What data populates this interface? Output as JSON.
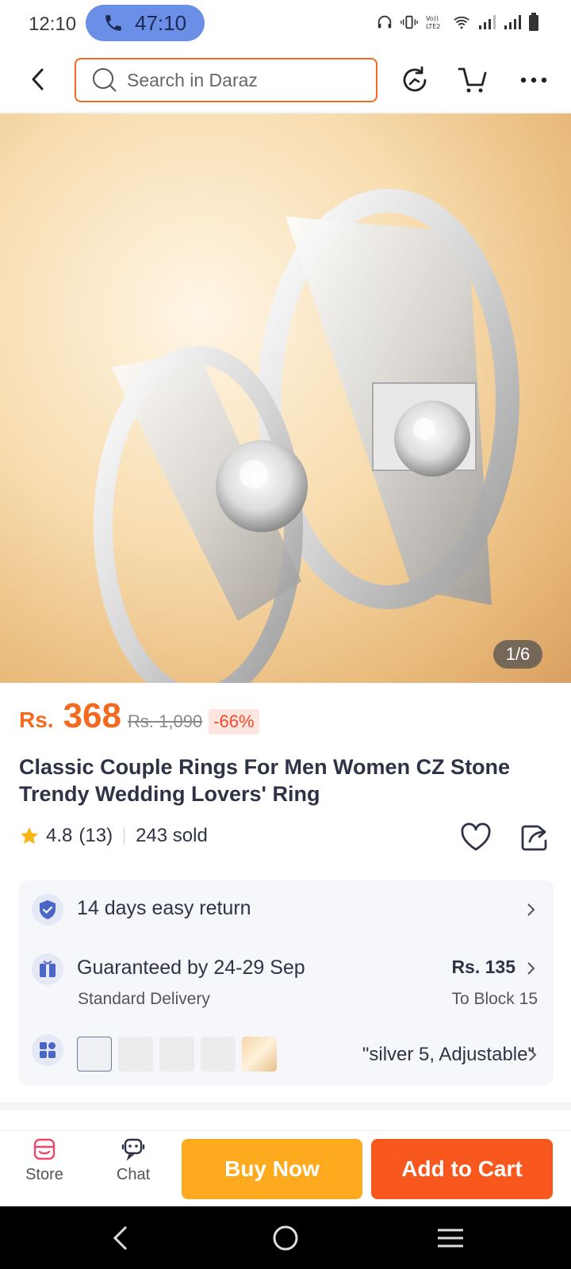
{
  "status_bar": {
    "time": "12:10",
    "call_duration": "47:10",
    "network_label": "Vo)) LTE2"
  },
  "header": {
    "search_placeholder": "Search in Daraz",
    "icons": [
      "back-arrow-icon",
      "search-icon",
      "refresh-icon",
      "cart-icon",
      "more-icon"
    ],
    "accent_color": "#f26a20"
  },
  "gallery": {
    "counter": "1/6"
  },
  "product": {
    "currency": "Rs.",
    "price": "368",
    "original_price": "Rs. 1,090",
    "discount": "-66%",
    "title": "Classic Couple Rings For Men Women CZ Stone Trendy Wedding Lovers' Ring",
    "rating": "4.8",
    "rating_count": "(13)",
    "sold": "243 sold"
  },
  "services": {
    "return_label": "14 days easy return",
    "delivery_label": "Guaranteed by 24-29 Sep",
    "delivery_type": "Standard Delivery",
    "delivery_fee": "Rs. 135",
    "delivery_location": "To Block 15",
    "variant_selected": "\"silver 5, Adjustable\""
  },
  "bottom_bar": {
    "store_label": "Store",
    "chat_label": "Chat",
    "buy_now_label": "Buy Now",
    "add_to_cart_label": "Add to Cart",
    "buy_color": "#fdaa1f",
    "cart_color": "#f8581d"
  }
}
